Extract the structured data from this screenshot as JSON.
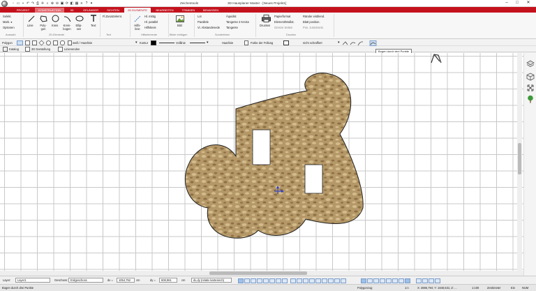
{
  "window": {
    "app_title": "3D-Hausplaner Master - [Neues Projekt1]",
    "context_title": "Zeichentools",
    "controls": [
      "–",
      "□",
      "✕"
    ]
  },
  "ribbon_tabs": [
    {
      "label": "PROJEKT"
    },
    {
      "label": "KONSTRUKTION"
    },
    {
      "label": "3D"
    },
    {
      "label": "GELÄNDER"
    },
    {
      "label": "SICHTEN"
    },
    {
      "label": "2D ELEMENTE"
    },
    {
      "label": "BEARBEITEN"
    },
    {
      "label": "TRIMMEN"
    },
    {
      "label": "BEMASSEN"
    }
  ],
  "ribbon": {
    "auswahl": {
      "items": [
        "Selekt.",
        "Mark. ▾",
        "Optionen"
      ],
      "label": "Auswahl"
    },
    "elements2d": {
      "items": [
        "Linie",
        "Poly-gon",
        "Kreis",
        "Kreis-bogen",
        "Ellip-sen",
        "Text"
      ],
      "label": "2D-Elemente"
    },
    "text": {
      "items": [
        "Fl.Zusatzelemt."
      ],
      "label": "Text"
    },
    "hilfselemente": {
      "big": "Hilfs-linie",
      "items": [
        "Hl. mittig",
        "Hl. parallel",
        "Hilfskreis"
      ],
      "label": "Hilfselemente"
    },
    "bilder": {
      "big": "Bild",
      "label": "Bilder einfügen"
    },
    "sonder": {
      "items": [
        "Lot",
        "Parallele",
        "Vi. Abstandenede",
        "Äquidist",
        "Tangente 2 Kreise",
        "Tangente"
      ],
      "label": "Sonderlinien"
    },
    "drucken": {
      "big": "Drucken",
      "items": [
        "Papierformat",
        "Element/Maßst.",
        "Grenze Seiten",
        "Ränder einblend.",
        "Blatt position.",
        "Pos. zurücksetz."
      ],
      "label": "Drucken"
    }
  },
  "options_bar": {
    "polygon_label": "Polygon",
    "fill_label": "weiß / Haarlinie",
    "kontur_label": "Kontur",
    "linestyle_label": "Volllinie",
    "lineweight_label": "Haarlinie",
    "fuellung_label": "Farbe der Füllung",
    "schraffur_label": "nicht schraffiert",
    "colors": {
      "kontur": "#000000",
      "fuellung": "#ffffff"
    }
  },
  "options_bar2": {
    "katalog": "Katalog",
    "darstellung": "2D Darstellung",
    "linienenden": "Linienenden"
  },
  "tooltip": "Bogen durch drei Punkte",
  "status": {
    "layer_label": "Layer:",
    "layer_value": "Layer1",
    "geschoss_label": "Geschoss:",
    "geschoss_value": "Erdgeschoss",
    "dx_label": "dx =",
    "dx_value": "1054,752",
    "cm1": "cm",
    "dy_label": "dy =",
    "dy_value": "608,961",
    "cm2": "cm",
    "mode": "dx,dy (relativ kartesisch)"
  },
  "statusbar": {
    "hint": "Bogen durch drei Punkte",
    "object": "Polygonzug",
    "mode1": "1:n",
    "coords": "X: 2886,794; Y: 1840,531; Z: ...",
    "scale": "1:100",
    "unit": "Zentimeter",
    "ein": "Ein",
    "num": "NUM"
  },
  "texture": {
    "base": "#b59867",
    "light": "#d3bb8c",
    "dark": "#8c6f45"
  }
}
